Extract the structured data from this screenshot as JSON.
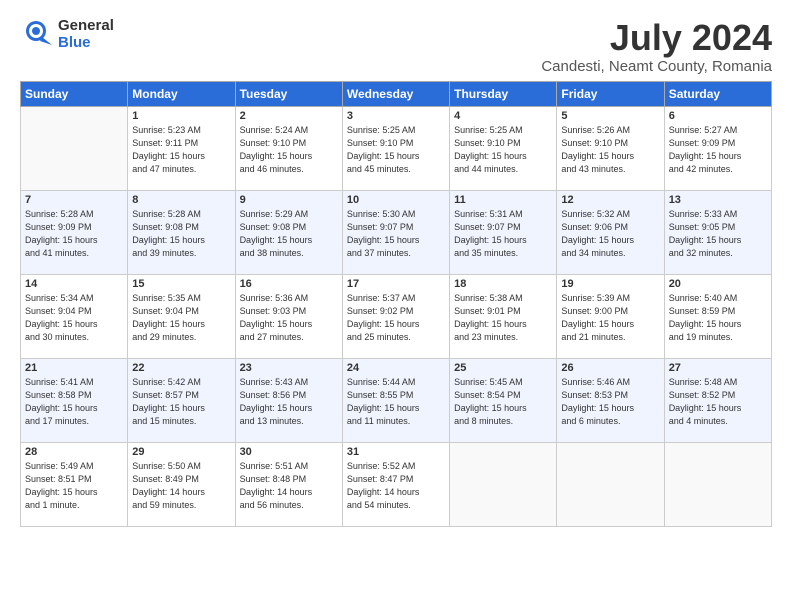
{
  "header": {
    "logo_general": "General",
    "logo_blue": "Blue",
    "title": "July 2024",
    "subtitle": "Candesti, Neamt County, Romania"
  },
  "weekdays": [
    "Sunday",
    "Monday",
    "Tuesday",
    "Wednesday",
    "Thursday",
    "Friday",
    "Saturday"
  ],
  "weeks": [
    [
      {
        "day": "",
        "info": ""
      },
      {
        "day": "1",
        "info": "Sunrise: 5:23 AM\nSunset: 9:11 PM\nDaylight: 15 hours\nand 47 minutes."
      },
      {
        "day": "2",
        "info": "Sunrise: 5:24 AM\nSunset: 9:10 PM\nDaylight: 15 hours\nand 46 minutes."
      },
      {
        "day": "3",
        "info": "Sunrise: 5:25 AM\nSunset: 9:10 PM\nDaylight: 15 hours\nand 45 minutes."
      },
      {
        "day": "4",
        "info": "Sunrise: 5:25 AM\nSunset: 9:10 PM\nDaylight: 15 hours\nand 44 minutes."
      },
      {
        "day": "5",
        "info": "Sunrise: 5:26 AM\nSunset: 9:10 PM\nDaylight: 15 hours\nand 43 minutes."
      },
      {
        "day": "6",
        "info": "Sunrise: 5:27 AM\nSunset: 9:09 PM\nDaylight: 15 hours\nand 42 minutes."
      }
    ],
    [
      {
        "day": "7",
        "info": "Sunrise: 5:28 AM\nSunset: 9:09 PM\nDaylight: 15 hours\nand 41 minutes."
      },
      {
        "day": "8",
        "info": "Sunrise: 5:28 AM\nSunset: 9:08 PM\nDaylight: 15 hours\nand 39 minutes."
      },
      {
        "day": "9",
        "info": "Sunrise: 5:29 AM\nSunset: 9:08 PM\nDaylight: 15 hours\nand 38 minutes."
      },
      {
        "day": "10",
        "info": "Sunrise: 5:30 AM\nSunset: 9:07 PM\nDaylight: 15 hours\nand 37 minutes."
      },
      {
        "day": "11",
        "info": "Sunrise: 5:31 AM\nSunset: 9:07 PM\nDaylight: 15 hours\nand 35 minutes."
      },
      {
        "day": "12",
        "info": "Sunrise: 5:32 AM\nSunset: 9:06 PM\nDaylight: 15 hours\nand 34 minutes."
      },
      {
        "day": "13",
        "info": "Sunrise: 5:33 AM\nSunset: 9:05 PM\nDaylight: 15 hours\nand 32 minutes."
      }
    ],
    [
      {
        "day": "14",
        "info": "Sunrise: 5:34 AM\nSunset: 9:04 PM\nDaylight: 15 hours\nand 30 minutes."
      },
      {
        "day": "15",
        "info": "Sunrise: 5:35 AM\nSunset: 9:04 PM\nDaylight: 15 hours\nand 29 minutes."
      },
      {
        "day": "16",
        "info": "Sunrise: 5:36 AM\nSunset: 9:03 PM\nDaylight: 15 hours\nand 27 minutes."
      },
      {
        "day": "17",
        "info": "Sunrise: 5:37 AM\nSunset: 9:02 PM\nDaylight: 15 hours\nand 25 minutes."
      },
      {
        "day": "18",
        "info": "Sunrise: 5:38 AM\nSunset: 9:01 PM\nDaylight: 15 hours\nand 23 minutes."
      },
      {
        "day": "19",
        "info": "Sunrise: 5:39 AM\nSunset: 9:00 PM\nDaylight: 15 hours\nand 21 minutes."
      },
      {
        "day": "20",
        "info": "Sunrise: 5:40 AM\nSunset: 8:59 PM\nDaylight: 15 hours\nand 19 minutes."
      }
    ],
    [
      {
        "day": "21",
        "info": "Sunrise: 5:41 AM\nSunset: 8:58 PM\nDaylight: 15 hours\nand 17 minutes."
      },
      {
        "day": "22",
        "info": "Sunrise: 5:42 AM\nSunset: 8:57 PM\nDaylight: 15 hours\nand 15 minutes."
      },
      {
        "day": "23",
        "info": "Sunrise: 5:43 AM\nSunset: 8:56 PM\nDaylight: 15 hours\nand 13 minutes."
      },
      {
        "day": "24",
        "info": "Sunrise: 5:44 AM\nSunset: 8:55 PM\nDaylight: 15 hours\nand 11 minutes."
      },
      {
        "day": "25",
        "info": "Sunrise: 5:45 AM\nSunset: 8:54 PM\nDaylight: 15 hours\nand 8 minutes."
      },
      {
        "day": "26",
        "info": "Sunrise: 5:46 AM\nSunset: 8:53 PM\nDaylight: 15 hours\nand 6 minutes."
      },
      {
        "day": "27",
        "info": "Sunrise: 5:48 AM\nSunset: 8:52 PM\nDaylight: 15 hours\nand 4 minutes."
      }
    ],
    [
      {
        "day": "28",
        "info": "Sunrise: 5:49 AM\nSunset: 8:51 PM\nDaylight: 15 hours\nand 1 minute."
      },
      {
        "day": "29",
        "info": "Sunrise: 5:50 AM\nSunset: 8:49 PM\nDaylight: 14 hours\nand 59 minutes."
      },
      {
        "day": "30",
        "info": "Sunrise: 5:51 AM\nSunset: 8:48 PM\nDaylight: 14 hours\nand 56 minutes."
      },
      {
        "day": "31",
        "info": "Sunrise: 5:52 AM\nSunset: 8:47 PM\nDaylight: 14 hours\nand 54 minutes."
      },
      {
        "day": "",
        "info": ""
      },
      {
        "day": "",
        "info": ""
      },
      {
        "day": "",
        "info": ""
      }
    ]
  ]
}
